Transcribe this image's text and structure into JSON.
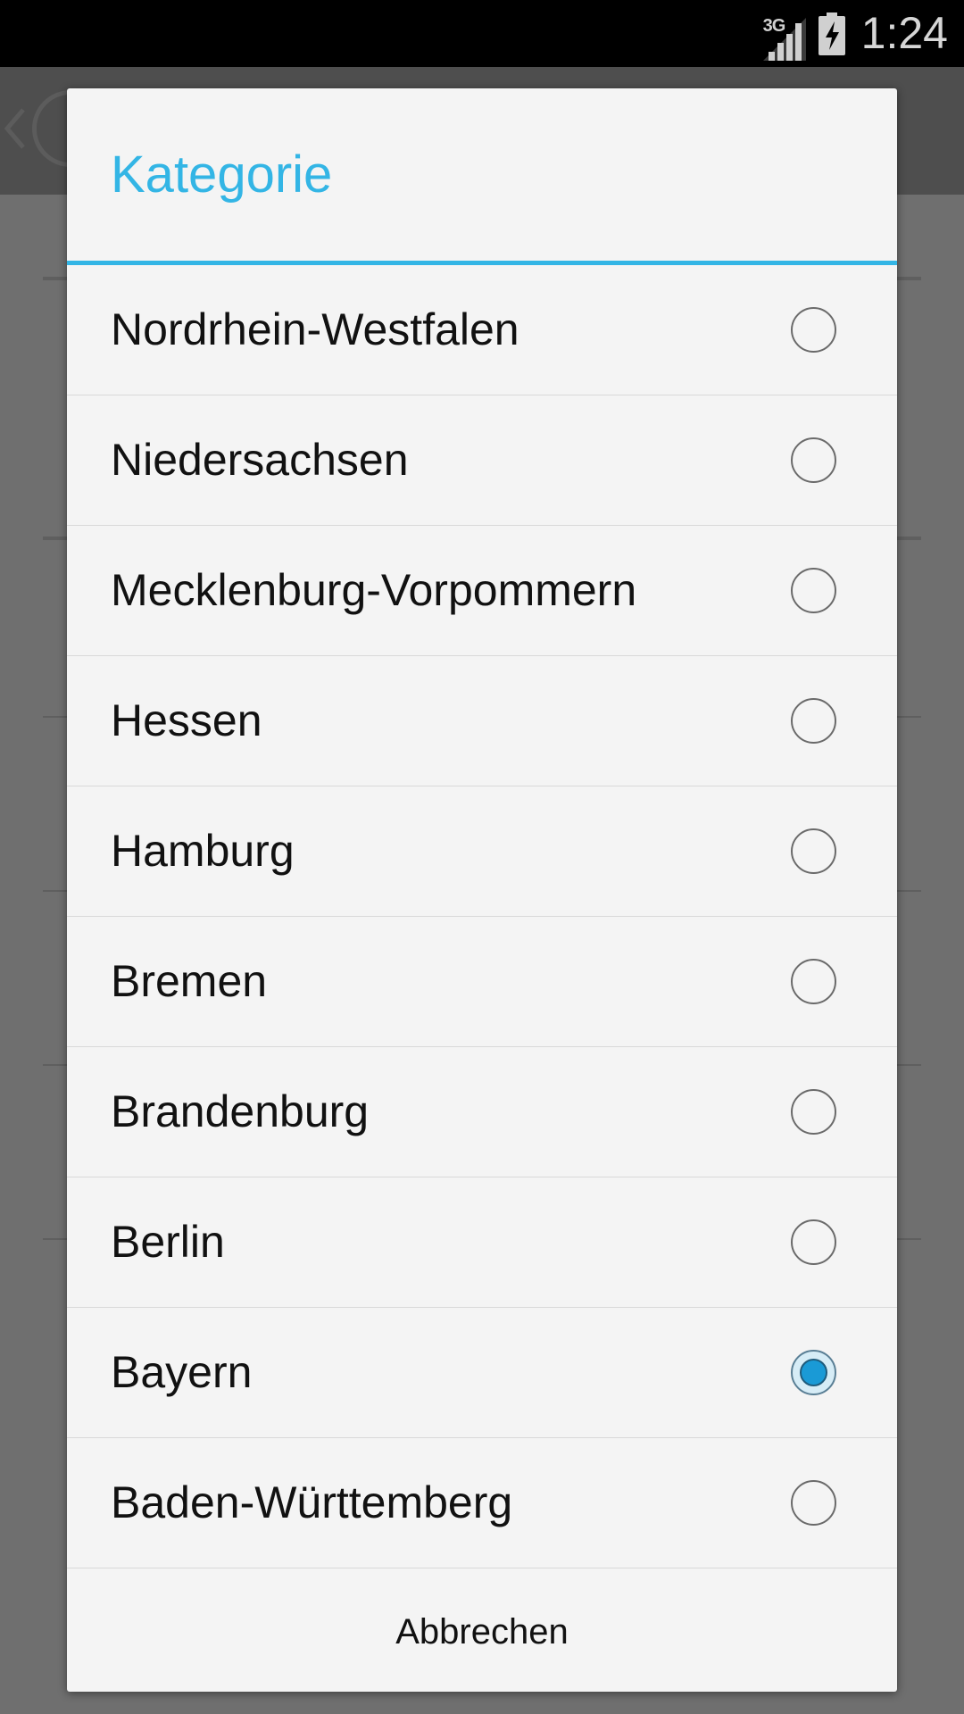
{
  "status_bar": {
    "network_type": "3G",
    "time": "1:24",
    "icons": [
      "signal-icon",
      "battery-charging-icon"
    ]
  },
  "dialog": {
    "title": "Kategorie",
    "options": [
      {
        "label": "Nordrhein-Westfalen",
        "selected": false
      },
      {
        "label": "Niedersachsen",
        "selected": false
      },
      {
        "label": "Mecklenburg-Vorpommern",
        "selected": false
      },
      {
        "label": "Hessen",
        "selected": false
      },
      {
        "label": "Hamburg",
        "selected": false
      },
      {
        "label": "Bremen",
        "selected": false
      },
      {
        "label": "Brandenburg",
        "selected": false
      },
      {
        "label": "Berlin",
        "selected": false
      },
      {
        "label": "Bayern",
        "selected": true
      },
      {
        "label": "Baden-Württemberg",
        "selected": false
      }
    ],
    "cancel_label": "Abbrechen"
  },
  "colors": {
    "accent": "#33b5e5",
    "radio_checked": "#1a9ad6",
    "dialog_background": "#f4f4f4",
    "scrim": "#6f6f6f",
    "status_bar": "#000000"
  }
}
